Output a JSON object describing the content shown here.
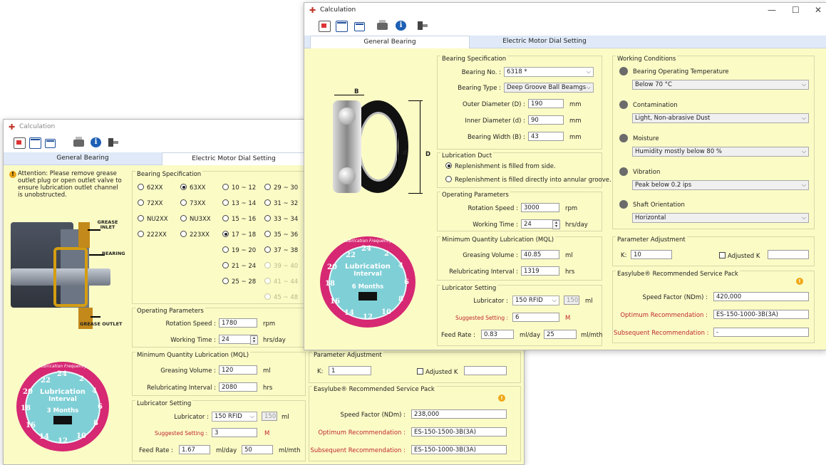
{
  "back": {
    "title": "Calculation",
    "tabs": [
      "General Bearing",
      "Electric Motor Dial Setting"
    ],
    "attention": "Attention: Please remove grease outlet plug or open outlet valve to ensure lubrication outlet channel is unobstructed.",
    "image_labels": {
      "inlet": "GREASE INLET",
      "bearing": "BEARING",
      "outlet": "GREASE OUTLET"
    },
    "bearing_spec": {
      "title": "Bearing Specification",
      "options": [
        {
          "label": "62XX",
          "selected": false,
          "enabled": true
        },
        {
          "label": "63XX",
          "selected": true,
          "enabled": true
        },
        {
          "label": "10 ~ 12",
          "selected": false,
          "enabled": true
        },
        {
          "label": "29 ~ 30",
          "selected": false,
          "enabled": true
        },
        {
          "label": "72XX",
          "selected": false,
          "enabled": true
        },
        {
          "label": "73XX",
          "selected": false,
          "enabled": true
        },
        {
          "label": "13 ~ 14",
          "selected": false,
          "enabled": true
        },
        {
          "label": "31 ~ 32",
          "selected": false,
          "enabled": true
        },
        {
          "label": "NU2XX",
          "selected": false,
          "enabled": true
        },
        {
          "label": "NU3XX",
          "selected": false,
          "enabled": true
        },
        {
          "label": "15 ~ 16",
          "selected": false,
          "enabled": true
        },
        {
          "label": "33 ~ 34",
          "selected": false,
          "enabled": true
        },
        {
          "label": "222XX",
          "selected": false,
          "enabled": true
        },
        {
          "label": "223XX",
          "selected": false,
          "enabled": true
        },
        {
          "label": "17 ~ 18",
          "selected": true,
          "enabled": true
        },
        {
          "label": "35 ~ 36",
          "selected": false,
          "enabled": true
        },
        {
          "label": "19 ~ 20",
          "selected": false,
          "enabled": true
        },
        {
          "label": "37 ~ 38",
          "selected": false,
          "enabled": true
        },
        {
          "label": "21 ~ 24",
          "selected": false,
          "enabled": true
        },
        {
          "label": "39 ~ 40",
          "selected": false,
          "enabled": false
        },
        {
          "label": "25 ~ 28",
          "selected": false,
          "enabled": true
        },
        {
          "label": "41 ~ 44",
          "selected": false,
          "enabled": false
        },
        {
          "label": "45 ~ 48",
          "selected": false,
          "enabled": false
        }
      ]
    },
    "operating": {
      "title": "Operating Parameters",
      "speed_label": "Rotation Speed :",
      "speed": "1780",
      "speed_unit": "rpm",
      "time_label": "Working Time :",
      "time": "24",
      "time_unit": "hrs/day"
    },
    "mql": {
      "title": "Minimum Quantity Lubrication (MQL)",
      "vol_label": "Greasing Volume :",
      "vol": "120",
      "vol_unit": "ml",
      "int_label": "Relubricating Interval :",
      "int": "2080",
      "int_unit": "hrs"
    },
    "lubricator": {
      "title": "Lubricator Setting",
      "lub_label": "Lubricator :",
      "lub": "150 RFID",
      "cap": "150",
      "cap_unit": "ml",
      "sugg_label": "Suggested Setting :",
      "sugg": "3",
      "sugg_unit": "M",
      "feed_label": "Feed Rate :",
      "feed_day": "1.67",
      "feed_day_unit": "ml/day",
      "feed_mth": "50",
      "feed_mth_unit": "ml/mth"
    },
    "param": {
      "title": "Parameter Adjustment",
      "k_label": "K:",
      "k": "1",
      "adj_label": "Adjusted K"
    },
    "service": {
      "title": "Easylube® Recommended Service Pack",
      "speed_label": "Speed Factor (NDm) :",
      "speed": "238,000",
      "opt_label": "Optimum Recommendation :",
      "opt": "ES-150-1500-3B(3A)",
      "sub_label": "Subsequent Recommendation :",
      "sub": "ES-150-1000-3B(3A)"
    },
    "gauge": {
      "arc": "Lubrication Frequency",
      "line1": "Lubrication",
      "line2": "Interval",
      "months": "3 Months",
      "nums": [
        "22",
        "24",
        "2",
        "4",
        "6",
        "8",
        "10",
        "12",
        "14",
        "16",
        "18",
        "20"
      ]
    }
  },
  "front": {
    "title": "Calculation",
    "win_controls": {
      "min": "—",
      "max": "☐",
      "close": "✕"
    },
    "tabs": [
      "General Bearing",
      "Electric Motor Dial Setting"
    ],
    "diagram_labels": {
      "b": "B",
      "d": "d",
      "D": "D"
    },
    "bearing_spec": {
      "title": "Bearing Specification",
      "no_label": "Bearing No. :",
      "no": "6318 *",
      "type_label": "Bearing Type :",
      "type": "Deep Groove Ball Beamgs",
      "od_label": "Outer Diameter (D) :",
      "od": "190",
      "id_label": "Inner Diameter (d) :",
      "id": "90",
      "w_label": "Bearing Width (B) :",
      "w": "43",
      "unit": "mm"
    },
    "duct": {
      "title": "Lubrication Duct",
      "opt1": "Replenishment is filled from side.",
      "opt2": "Replenishment is filled directly into annular groove."
    },
    "operating": {
      "title": "Operating Parameters",
      "speed_label": "Rotation Speed :",
      "speed": "3000",
      "speed_unit": "rpm",
      "time_label": "Working Time :",
      "time": "24",
      "time_unit": "hrs/day"
    },
    "mql": {
      "title": "Minimum Quantity Lubrication (MQL)",
      "vol_label": "Greasing Volume :",
      "vol": "40.85",
      "vol_unit": "ml",
      "int_label": "Relubricating Interval :",
      "int": "1319",
      "int_unit": "hrs"
    },
    "lubricator": {
      "title": "Lubricator Setting",
      "lub_label": "Lubricator :",
      "lub": "150 RFID",
      "cap": "150",
      "cap_unit": "ml",
      "sugg_label": "Suggested Setting :",
      "sugg": "6",
      "sugg_unit": "M",
      "feed_label": "Feed Rate :",
      "feed_day": "0.83",
      "feed_day_unit": "ml/day",
      "feed_mth": "25",
      "feed_mth_unit": "ml/mth"
    },
    "working": {
      "title": "Working Conditions",
      "items": [
        {
          "label": "Bearing Operating Temperature",
          "value": "Below 70 °C"
        },
        {
          "label": "Contamination",
          "value": "Light, Non-abrasive Dust"
        },
        {
          "label": "Moisture",
          "value": "Humidity mostly below 80 %"
        },
        {
          "label": "Vibration",
          "value": "Peak below 0.2 ips"
        },
        {
          "label": "Shaft Orientation",
          "value": "Horizontal"
        }
      ]
    },
    "param": {
      "title": "Parameter Adjustment",
      "k_label": "K:",
      "k": "10",
      "adj_label": "Adjusted K"
    },
    "service": {
      "title": "Easylube® Recommended Service Pack",
      "speed_label": "Speed Factor (NDm) :",
      "speed": "420,000",
      "opt_label": "Optimum Recommendation :",
      "opt": "ES-150-1000-3B(3A)",
      "sub_label": "Subsequent Recommendation :",
      "sub": "-"
    },
    "gauge": {
      "arc": "Lubrication Frequency",
      "line1": "Lubrication",
      "line2": "Interval",
      "months": "6 Months",
      "nums": [
        "22",
        "24",
        "2",
        "4",
        "6",
        "8",
        "10",
        "12",
        "14",
        "16",
        "18",
        "20"
      ]
    }
  }
}
